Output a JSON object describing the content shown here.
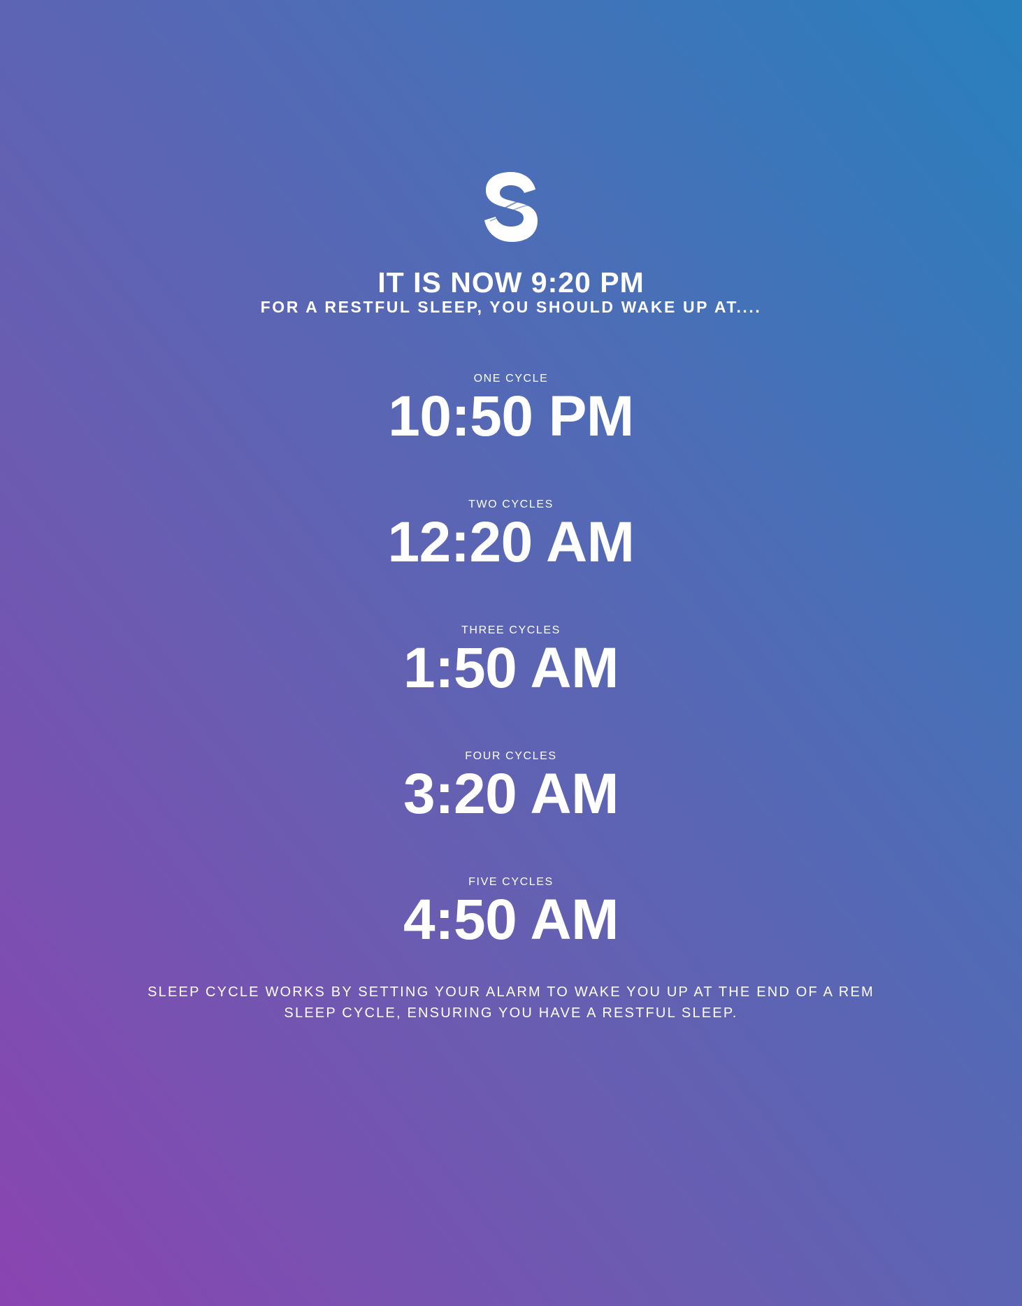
{
  "logo": {
    "icon": "sleep-cycle-s-logo-icon"
  },
  "header": {
    "current_time_text": "IT IS NOW 9:20 PM",
    "subtitle": "FOR A RESTFUL SLEEP, YOU SHOULD WAKE UP AT...."
  },
  "cycles": [
    {
      "label": "ONE CYCLE",
      "time": "10:50 PM"
    },
    {
      "label": "TWO CYCLES",
      "time": "12:20 AM"
    },
    {
      "label": "THREE CYCLES",
      "time": "1:50 AM"
    },
    {
      "label": "FOUR CYCLES",
      "time": "3:20 AM"
    },
    {
      "label": "FIVE CYCLES",
      "time": "4:50 AM"
    }
  ],
  "footer": {
    "text": "SLEEP CYCLE WORKS BY SETTING YOUR ALARM TO WAKE YOU UP AT THE END OF A REM SLEEP CYCLE, ENSURING YOU HAVE A RESTFUL SLEEP."
  },
  "colors": {
    "gradient_bottom_left": "#8a44b1",
    "gradient_top_right": "#2880bd",
    "text": "#ffffff"
  }
}
